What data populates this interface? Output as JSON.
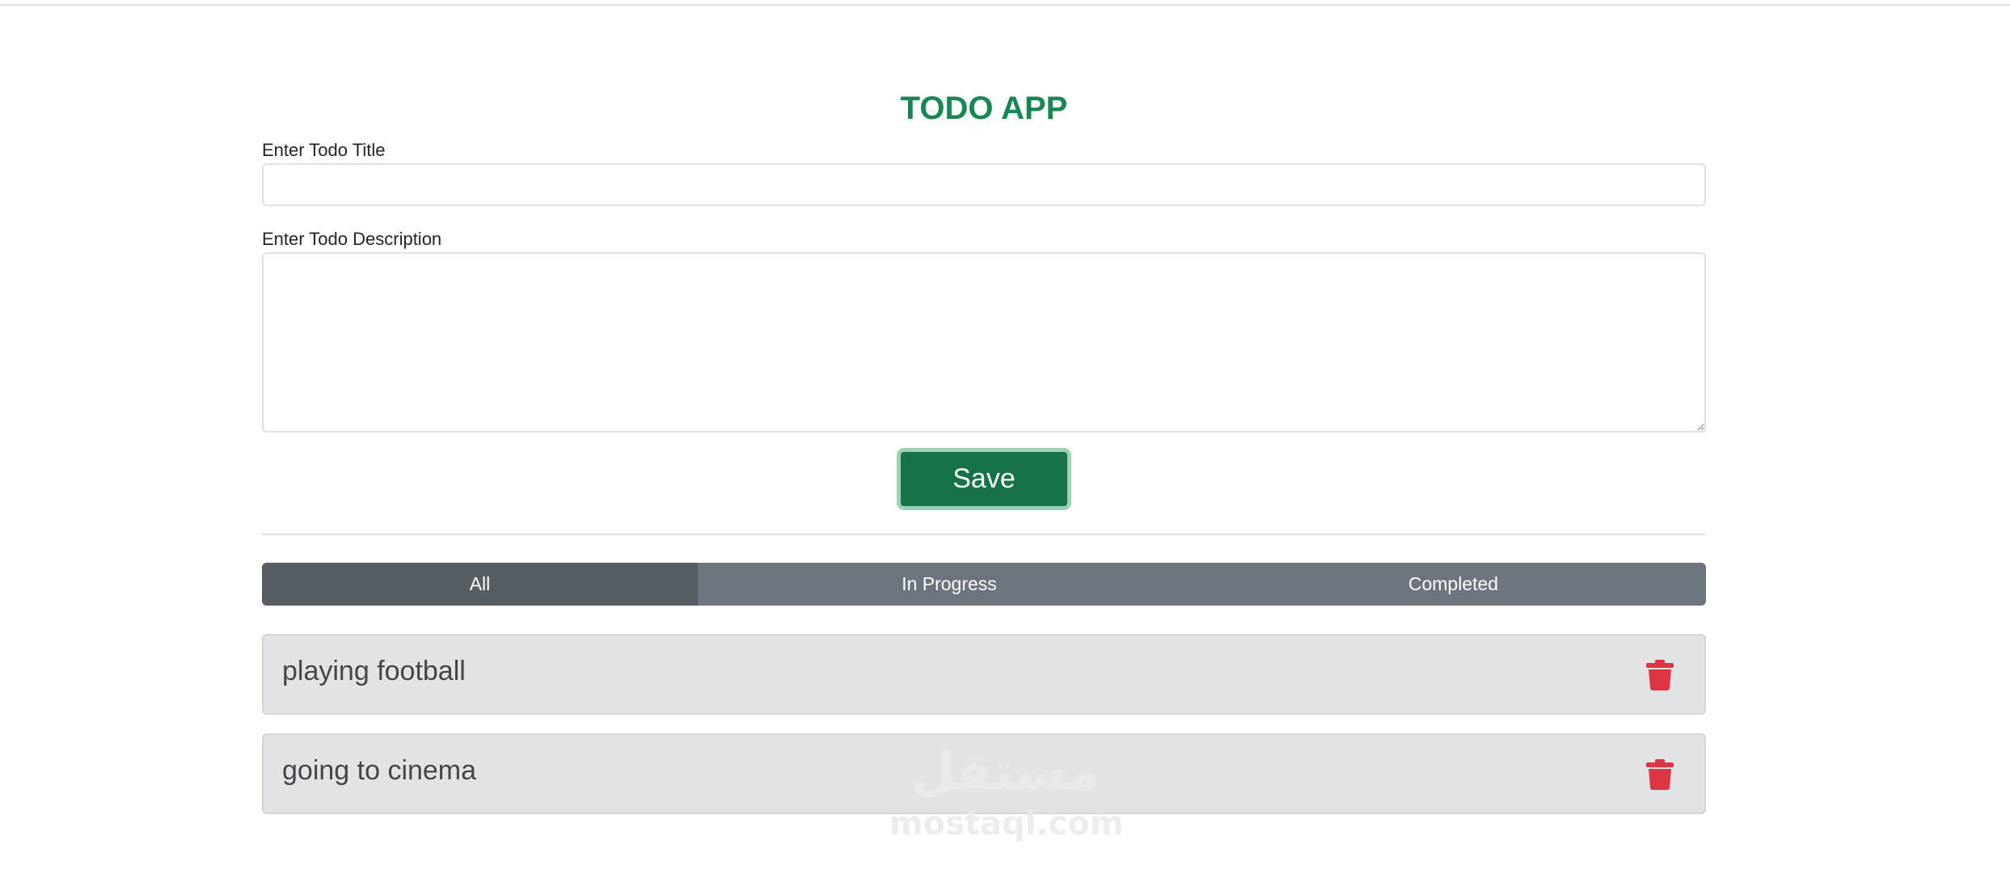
{
  "app": {
    "title": "TODO APP"
  },
  "form": {
    "title_label": "Enter Todo Title",
    "title_value": "",
    "description_label": "Enter Todo Description",
    "description_value": "",
    "save_label": "Save"
  },
  "filters": {
    "tabs": [
      {
        "label": "All",
        "active": true
      },
      {
        "label": "In Progress",
        "active": false
      },
      {
        "label": "Completed",
        "active": false
      }
    ]
  },
  "todos": [
    {
      "text": "playing football",
      "delete_icon": "trash-icon"
    },
    {
      "text": "going to cinema",
      "delete_icon": "trash-icon"
    }
  ],
  "watermark": {
    "arabic": "مستقل",
    "latin": "mostaql.com"
  },
  "colors": {
    "title": "#198754",
    "save_button": "#157347",
    "tab_bar": "#6c757d",
    "tab_active": "#565e64",
    "todo_bg": "#e2e3e5",
    "delete_icon": "#dc3545"
  }
}
